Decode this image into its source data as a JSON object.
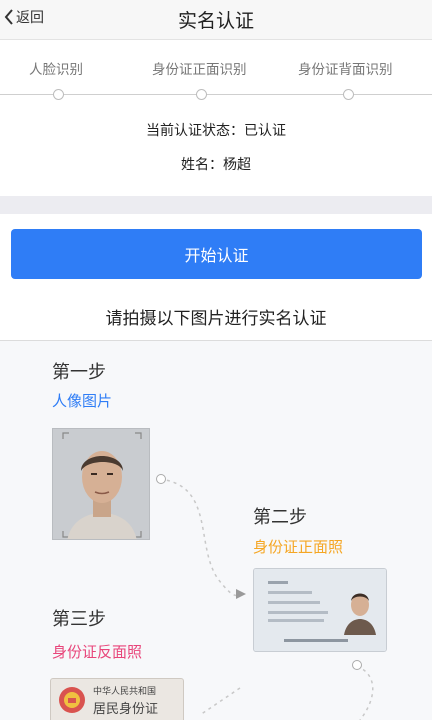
{
  "header": {
    "back_label": "返回",
    "title": "实名认证"
  },
  "progress": {
    "steps": [
      "人脸识别",
      "身份证正面识别",
      "身份证背面识别"
    ]
  },
  "status": {
    "auth_status": "当前认证状态：已认证",
    "name": "姓名：杨超"
  },
  "actions": {
    "start_label": "开始认证"
  },
  "instruction": "请拍摄以下图片进行实名认证",
  "guide": {
    "step1": {
      "title": "第一步",
      "subtitle": "人像图片",
      "color": "#2f7df6"
    },
    "step2": {
      "title": "第二步",
      "subtitle": "身份证正面照",
      "color": "#f5a623"
    },
    "step3": {
      "title": "第三步",
      "subtitle": "身份证反面照",
      "color": "#e8457a"
    },
    "id_back_line1": "中华人民共和国",
    "id_back_line2": "居民身份证"
  },
  "colors": {
    "accent": "#2f7df6"
  }
}
